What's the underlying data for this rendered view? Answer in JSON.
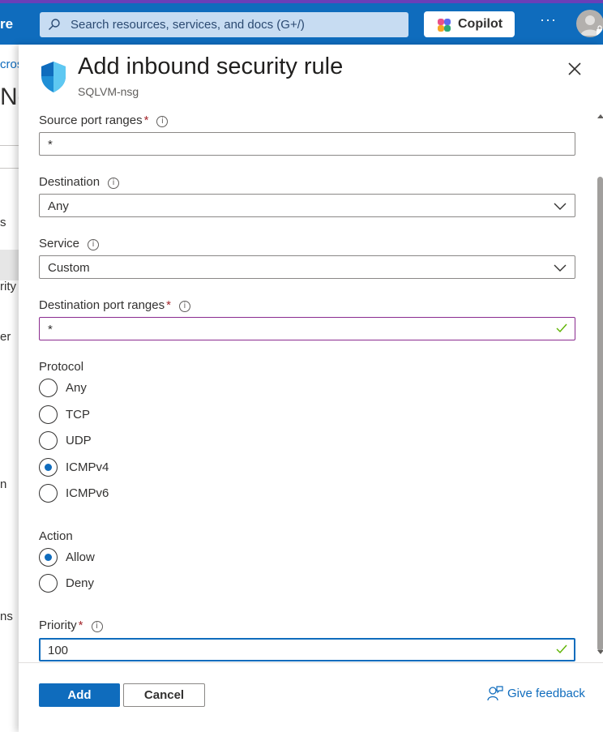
{
  "header": {
    "brand": "re",
    "search_placeholder": "Search resources, services, and docs (G+/)",
    "copilot_label": "Copilot",
    "more_label": "···"
  },
  "background": {
    "breadcrumb_fragment": "cros",
    "title_fragment": "Ne",
    "nav_fragments": [
      "s",
      "rity",
      "er",
      "n",
      "ns"
    ]
  },
  "panel": {
    "title": "Add inbound security rule",
    "subtitle": "SQLVM-nsg",
    "source_port": {
      "label": "Source port ranges",
      "required": "*",
      "value": "*"
    },
    "destination": {
      "label": "Destination",
      "value": "Any"
    },
    "service": {
      "label": "Service",
      "value": "Custom"
    },
    "dest_port": {
      "label": "Destination port ranges",
      "required": "*",
      "value": "*"
    },
    "protocol": {
      "label": "Protocol",
      "options": [
        "Any",
        "TCP",
        "UDP",
        "ICMPv4",
        "ICMPv6"
      ],
      "selected": "ICMPv4"
    },
    "action": {
      "label": "Action",
      "options": [
        "Allow",
        "Deny"
      ],
      "selected": "Allow"
    },
    "priority": {
      "label": "Priority",
      "required": "*",
      "value": "100"
    },
    "info_glyph": "i"
  },
  "footer": {
    "add_label": "Add",
    "cancel_label": "Cancel",
    "feedback_label": "Give feedback"
  },
  "colors": {
    "accent": "#0f6cbd",
    "required": "#a4262c",
    "valid": "#107c10"
  }
}
